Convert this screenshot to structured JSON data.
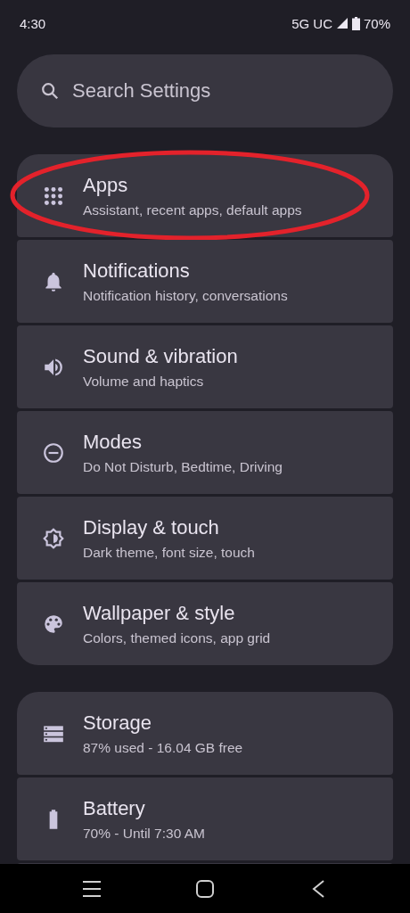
{
  "status_bar": {
    "time": "4:30",
    "network": "5G UC",
    "battery": "70%"
  },
  "search": {
    "placeholder": "Search Settings"
  },
  "groups": [
    {
      "items": [
        {
          "kind": "apps",
          "title": "Apps",
          "subtitle": "Assistant, recent apps, default apps",
          "highlighted": true
        },
        {
          "kind": "notifications",
          "title": "Notifications",
          "subtitle": "Notification history, conversations",
          "highlighted": false
        },
        {
          "kind": "sound",
          "title": "Sound & vibration",
          "subtitle": "Volume and haptics",
          "highlighted": false
        },
        {
          "kind": "modes",
          "title": "Modes",
          "subtitle": "Do Not Disturb, Bedtime, Driving",
          "highlighted": false
        },
        {
          "kind": "display",
          "title": "Display & touch",
          "subtitle": "Dark theme, font size, touch",
          "highlighted": false
        },
        {
          "kind": "wallpaper",
          "title": "Wallpaper & style",
          "subtitle": "Colors, themed icons, app grid",
          "highlighted": false
        }
      ]
    },
    {
      "items": [
        {
          "kind": "storage",
          "title": "Storage",
          "subtitle": "87% used - 16.04 GB free",
          "highlighted": false
        },
        {
          "kind": "battery",
          "title": "Battery",
          "subtitle": "70% - Until 7:30 AM",
          "highlighted": false
        }
      ]
    }
  ]
}
